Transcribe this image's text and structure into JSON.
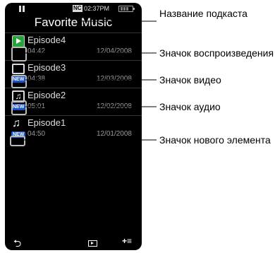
{
  "status": {
    "nc_label": "NC",
    "time": "02:37PM"
  },
  "title": "Favorite Music",
  "episodes": [
    {
      "name": "Episode4",
      "duration": "04:42",
      "date": "12/04/2008",
      "icon": "play-icon",
      "new": ""
    },
    {
      "name": "Episode3",
      "duration": "04:38",
      "date": "12/03/2008",
      "icon": "video-icon",
      "new": "NEW"
    },
    {
      "name": "Episode2",
      "duration": "05:01",
      "date": "12/02/2008",
      "icon": "audio-icon",
      "new": "NEW"
    },
    {
      "name": "Episode1",
      "duration": "04:50",
      "date": "12/01/2008",
      "icon": "music-note-icon",
      "new": "NEW"
    }
  ],
  "bottom": {
    "back_glyph": "⮌",
    "add_glyph": "+≡"
  },
  "annotations": {
    "podcast_name": "Название подкаста",
    "play_icon": "Значок воспроизведения",
    "video_icon": "Значок видео",
    "audio_icon": "Значок аудио",
    "new_item_icon": "Значок нового элемента"
  }
}
